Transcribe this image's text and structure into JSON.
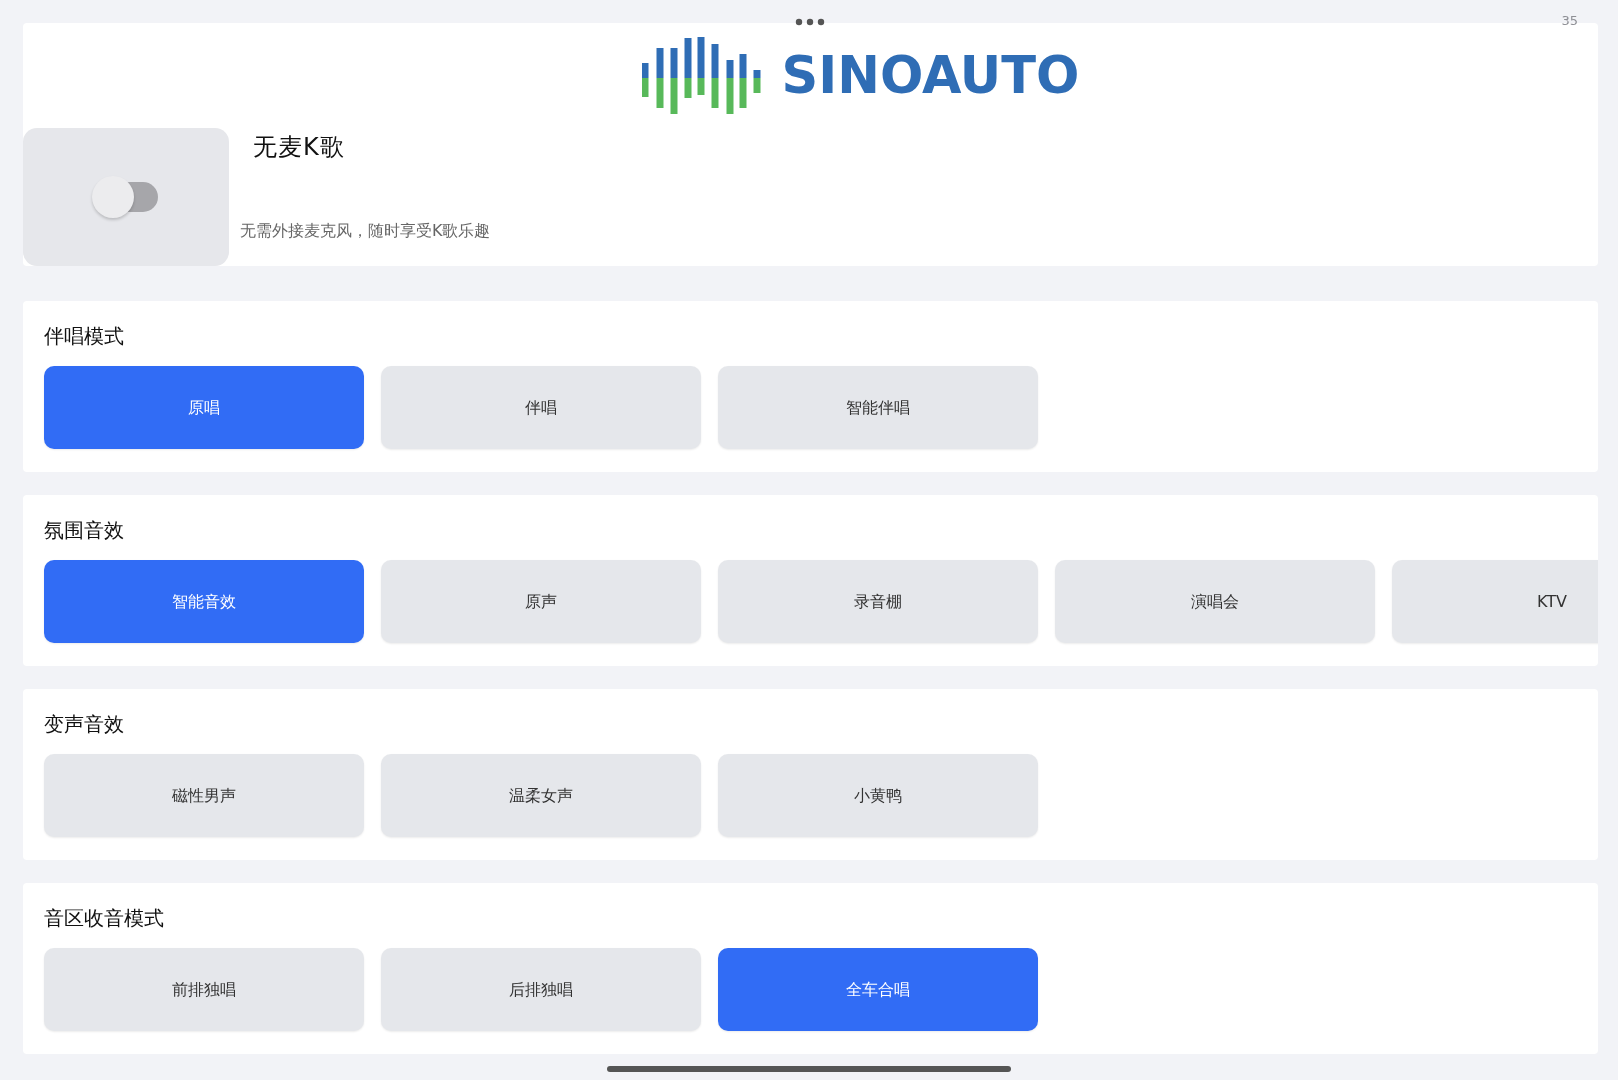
{
  "status_bar": {
    "battery": "35"
  },
  "header": {
    "logo_text": "SINOAUTO"
  },
  "feature": {
    "title": "无麦K歌",
    "description": "无需外接麦克风，随时享受K歌乐趣",
    "on": false
  },
  "sections": [
    {
      "title": "伴唱模式",
      "options": [
        {
          "label": "原唱",
          "selected": true
        },
        {
          "label": "伴唱",
          "selected": false
        },
        {
          "label": "智能伴唱",
          "selected": false
        }
      ]
    },
    {
      "title": "氛围音效",
      "options": [
        {
          "label": "智能音效",
          "selected": true
        },
        {
          "label": "原声",
          "selected": false
        },
        {
          "label": "录音棚",
          "selected": false
        },
        {
          "label": "演唱会",
          "selected": false
        },
        {
          "label": "KTV",
          "selected": false
        }
      ]
    },
    {
      "title": "变声音效",
      "options": [
        {
          "label": "磁性男声",
          "selected": false
        },
        {
          "label": "温柔女声",
          "selected": false
        },
        {
          "label": "小黄鸭",
          "selected": false
        }
      ]
    },
    {
      "title": "音区收音模式",
      "options": [
        {
          "label": "前排独唱",
          "selected": false
        },
        {
          "label": "后排独唱",
          "selected": false
        },
        {
          "label": "全车合唱",
          "selected": true
        }
      ]
    }
  ]
}
